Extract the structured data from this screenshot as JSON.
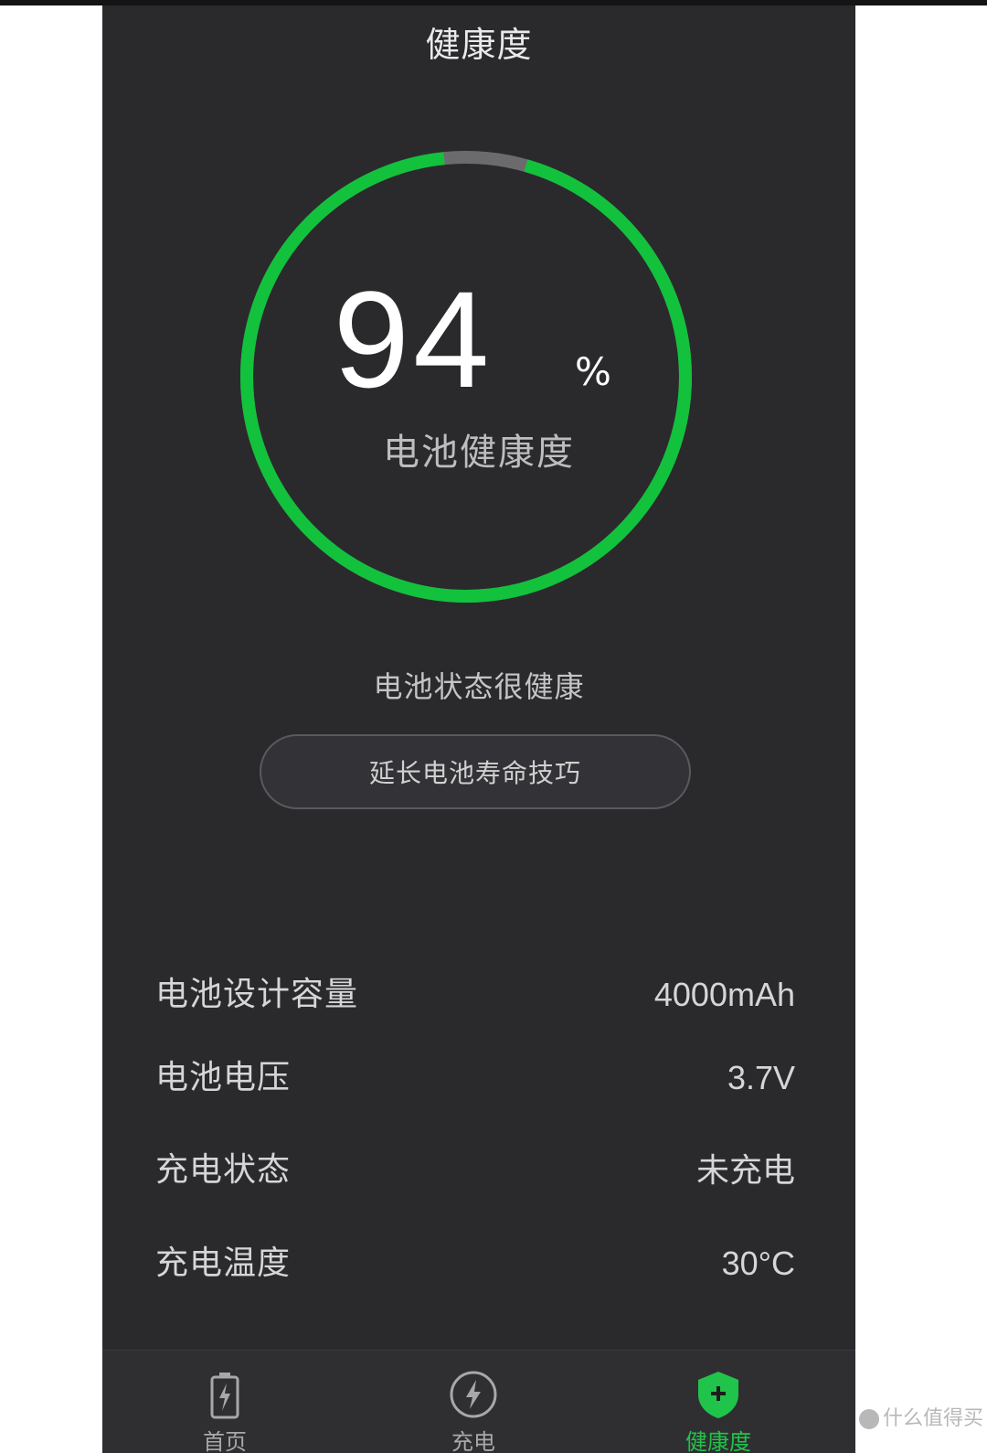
{
  "header": {
    "title": "健康度"
  },
  "gauge": {
    "value": "94",
    "unit": "%",
    "label": "电池健康度",
    "fraction": 0.94,
    "color_fill": "#12c23c",
    "color_track": "#6b6b6e"
  },
  "status": {
    "text": "电池状态很健康"
  },
  "tips_button": {
    "label": "延长电池寿命技巧"
  },
  "info": [
    {
      "label": "电池设计容量",
      "value": "4000mAh"
    },
    {
      "label": "电池电压",
      "value": "3.7V"
    },
    {
      "label": "充电状态",
      "value": "未充电"
    },
    {
      "label": "充电温度",
      "value": "30°C"
    }
  ],
  "tabs": [
    {
      "label": "首页",
      "icon": "battery-icon"
    },
    {
      "label": "充电",
      "icon": "lightning-icon"
    },
    {
      "label": "健康度",
      "icon": "shield-plus-icon",
      "active": true
    }
  ],
  "theme": {
    "background": "#2a2a2d",
    "accent": "#21c44a"
  },
  "watermark": {
    "text": "什么值得买"
  }
}
